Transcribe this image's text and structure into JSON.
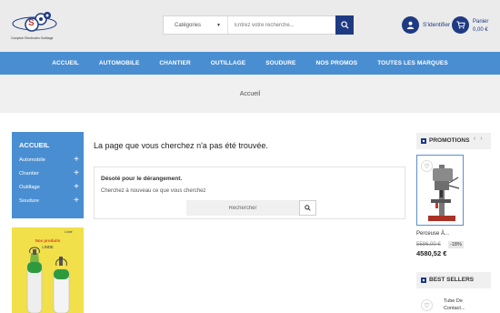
{
  "header": {
    "logo_text": "S",
    "logo_tagline": "Comptoir Electrodes Outillage",
    "search_category": "Catégories",
    "search_placeholder": "Entrez votre recherche...",
    "signin_label": "S'identifier",
    "cart_label": "Panier",
    "cart_total": "0,00 €"
  },
  "nav": {
    "items": [
      "ACCUEIL",
      "AUTOMOBILE",
      "CHANTIER",
      "OUTILLAGE",
      "SOUDURE",
      "NOS PROMOS",
      "TOUTES LES MARQUES"
    ]
  },
  "breadcrumb": "Accueil",
  "sidebar": {
    "title": "ACCUEIL",
    "items": [
      {
        "label": "Automobile"
      },
      {
        "label": "Chantier"
      },
      {
        "label": "Outillage"
      },
      {
        "label": "Soudure"
      }
    ],
    "banner_line1": "Nos produits",
    "banner_line2": "LINDE",
    "banner_brand": "Linde"
  },
  "main": {
    "title": "La page que vous cherchez n'a pas été trouvée.",
    "card_title": "Désolé pour le dérangement.",
    "card_subtitle": "Cherchez à nouveau ce que vous cherchez",
    "search_placeholder": "Rechercher"
  },
  "promotions": {
    "title": "PROMOTIONS",
    "product_name": "Perceuse À...",
    "old_price": "5586,00 €",
    "discount": "-18%",
    "price": "4580,52 €"
  },
  "best_sellers": {
    "title": "BEST SELLERS",
    "product_name_line1": "Tube De",
    "product_name_line2": "Contact..."
  },
  "colors": {
    "brand_dark": "#1e3a82",
    "nav_blue": "#4a8ed2",
    "header_bg": "#ebebeb"
  },
  "icons": [
    "search-icon",
    "user-icon",
    "cart-icon",
    "plus-icon",
    "heart-icon",
    "chevron-left-icon",
    "chevron-right-icon"
  ]
}
